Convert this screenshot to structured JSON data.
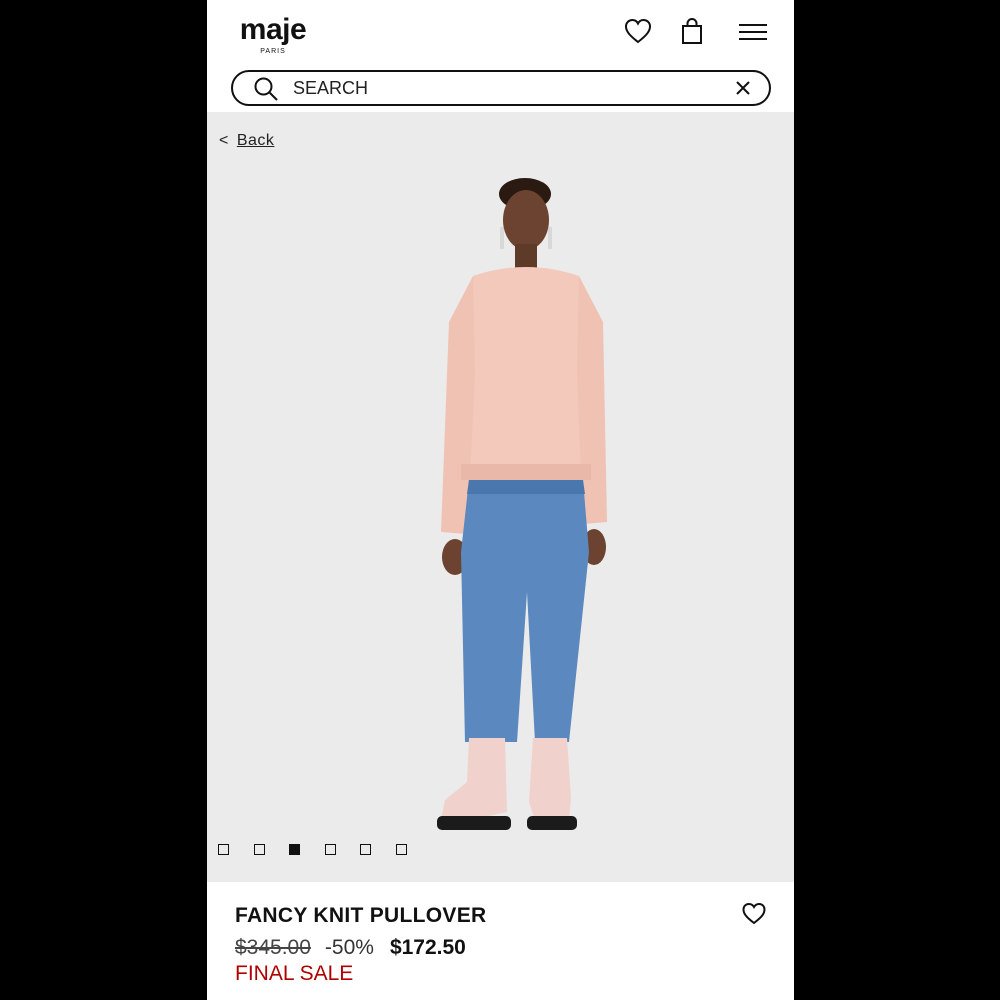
{
  "header": {
    "logo_text": "maje",
    "logo_sub": "PARIS",
    "icons": [
      "heart-icon",
      "shopping-bag-icon",
      "menu-icon"
    ]
  },
  "search": {
    "placeholder": "SEARCH",
    "value": ""
  },
  "product_image": {
    "back_chevron": "<",
    "back_label": "Back",
    "gallery_count": 6,
    "active_index": 2,
    "bg_color": "#ebebeb"
  },
  "product": {
    "name": "FANCY KNIT PULLOVER",
    "original_price": "$345.00",
    "discount": "-50%",
    "sale_price": "$172.50",
    "status": "FINAL SALE",
    "status_color": "#b00000"
  }
}
